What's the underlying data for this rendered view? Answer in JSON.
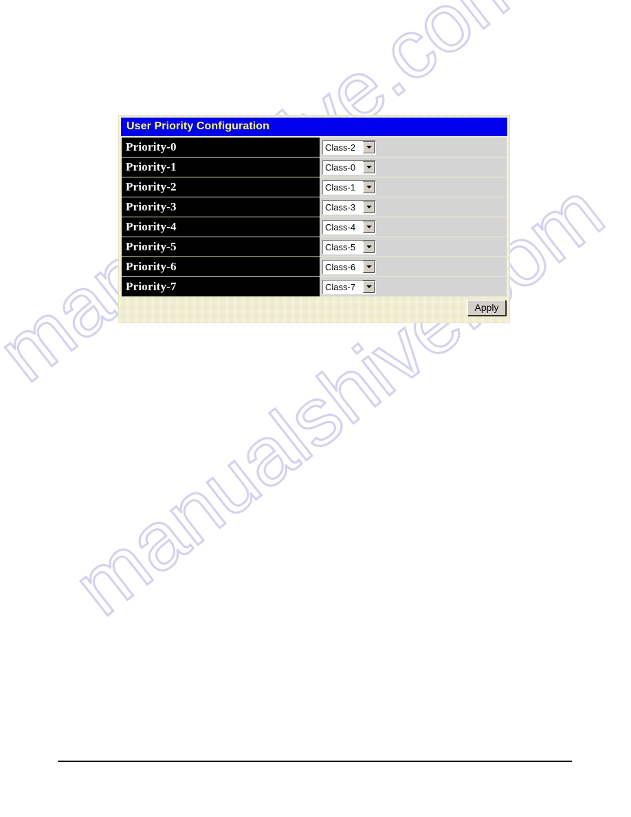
{
  "panel": {
    "title": "User Priority Configuration",
    "rows": [
      {
        "label": "Priority-0",
        "value": "Class-2"
      },
      {
        "label": "Priority-1",
        "value": "Class-0"
      },
      {
        "label": "Priority-2",
        "value": "Class-1"
      },
      {
        "label": "Priority-3",
        "value": "Class-3"
      },
      {
        "label": "Priority-4",
        "value": "Class-4"
      },
      {
        "label": "Priority-5",
        "value": "Class-5"
      },
      {
        "label": "Priority-6",
        "value": "Class-6"
      },
      {
        "label": "Priority-7",
        "value": "Class-7"
      }
    ],
    "apply_label": "Apply",
    "colors": {
      "title_bar": "#0000ee",
      "title_text": "#ffff66",
      "label_cell": "#000000",
      "label_text": "#ffffff",
      "field_cell": "#d4d4d4",
      "panel_background": "#f2efd6",
      "button_face": "#d4d0c8"
    }
  },
  "watermark": {
    "text": "manualshive.com",
    "color": "#c3c3e8"
  }
}
